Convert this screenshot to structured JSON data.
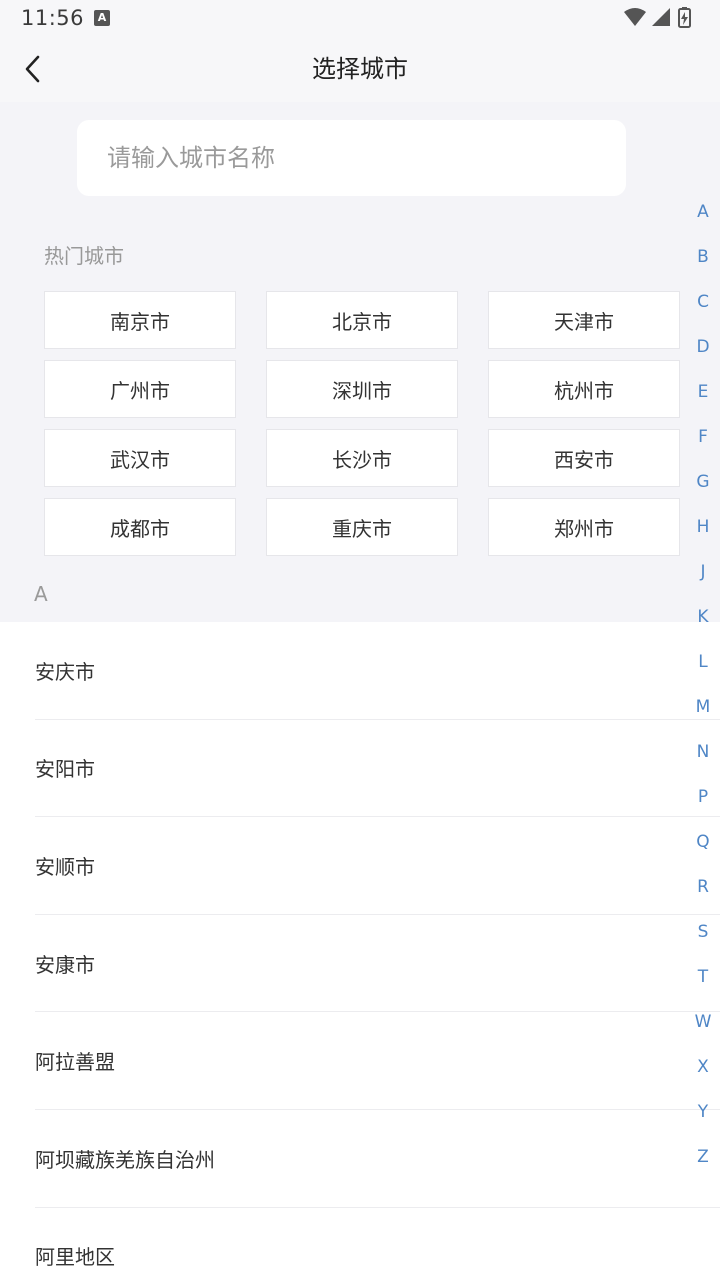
{
  "status_bar": {
    "time": "11:56",
    "notification_badge": "A"
  },
  "nav": {
    "title": "选择城市"
  },
  "search": {
    "placeholder": "请输入城市名称",
    "value": ""
  },
  "hot_cities": {
    "label": "热门城市",
    "items": [
      "南京市",
      "北京市",
      "天津市",
      "广州市",
      "深圳市",
      "杭州市",
      "武汉市",
      "长沙市",
      "西安市",
      "成都市",
      "重庆市",
      "郑州市"
    ]
  },
  "section": {
    "letter": "A",
    "cities": [
      "安庆市",
      "安阳市",
      "安顺市",
      "安康市",
      "阿拉善盟",
      "阿坝藏族羌族自治州",
      "阿里地区"
    ]
  },
  "index_letters": [
    "A",
    "B",
    "C",
    "D",
    "E",
    "F",
    "G",
    "H",
    "J",
    "K",
    "L",
    "M",
    "N",
    "P",
    "Q",
    "R",
    "S",
    "T",
    "W",
    "X",
    "Y",
    "Z"
  ],
  "colors": {
    "accent": "#4f86c6",
    "background": "#f4f4f8"
  }
}
